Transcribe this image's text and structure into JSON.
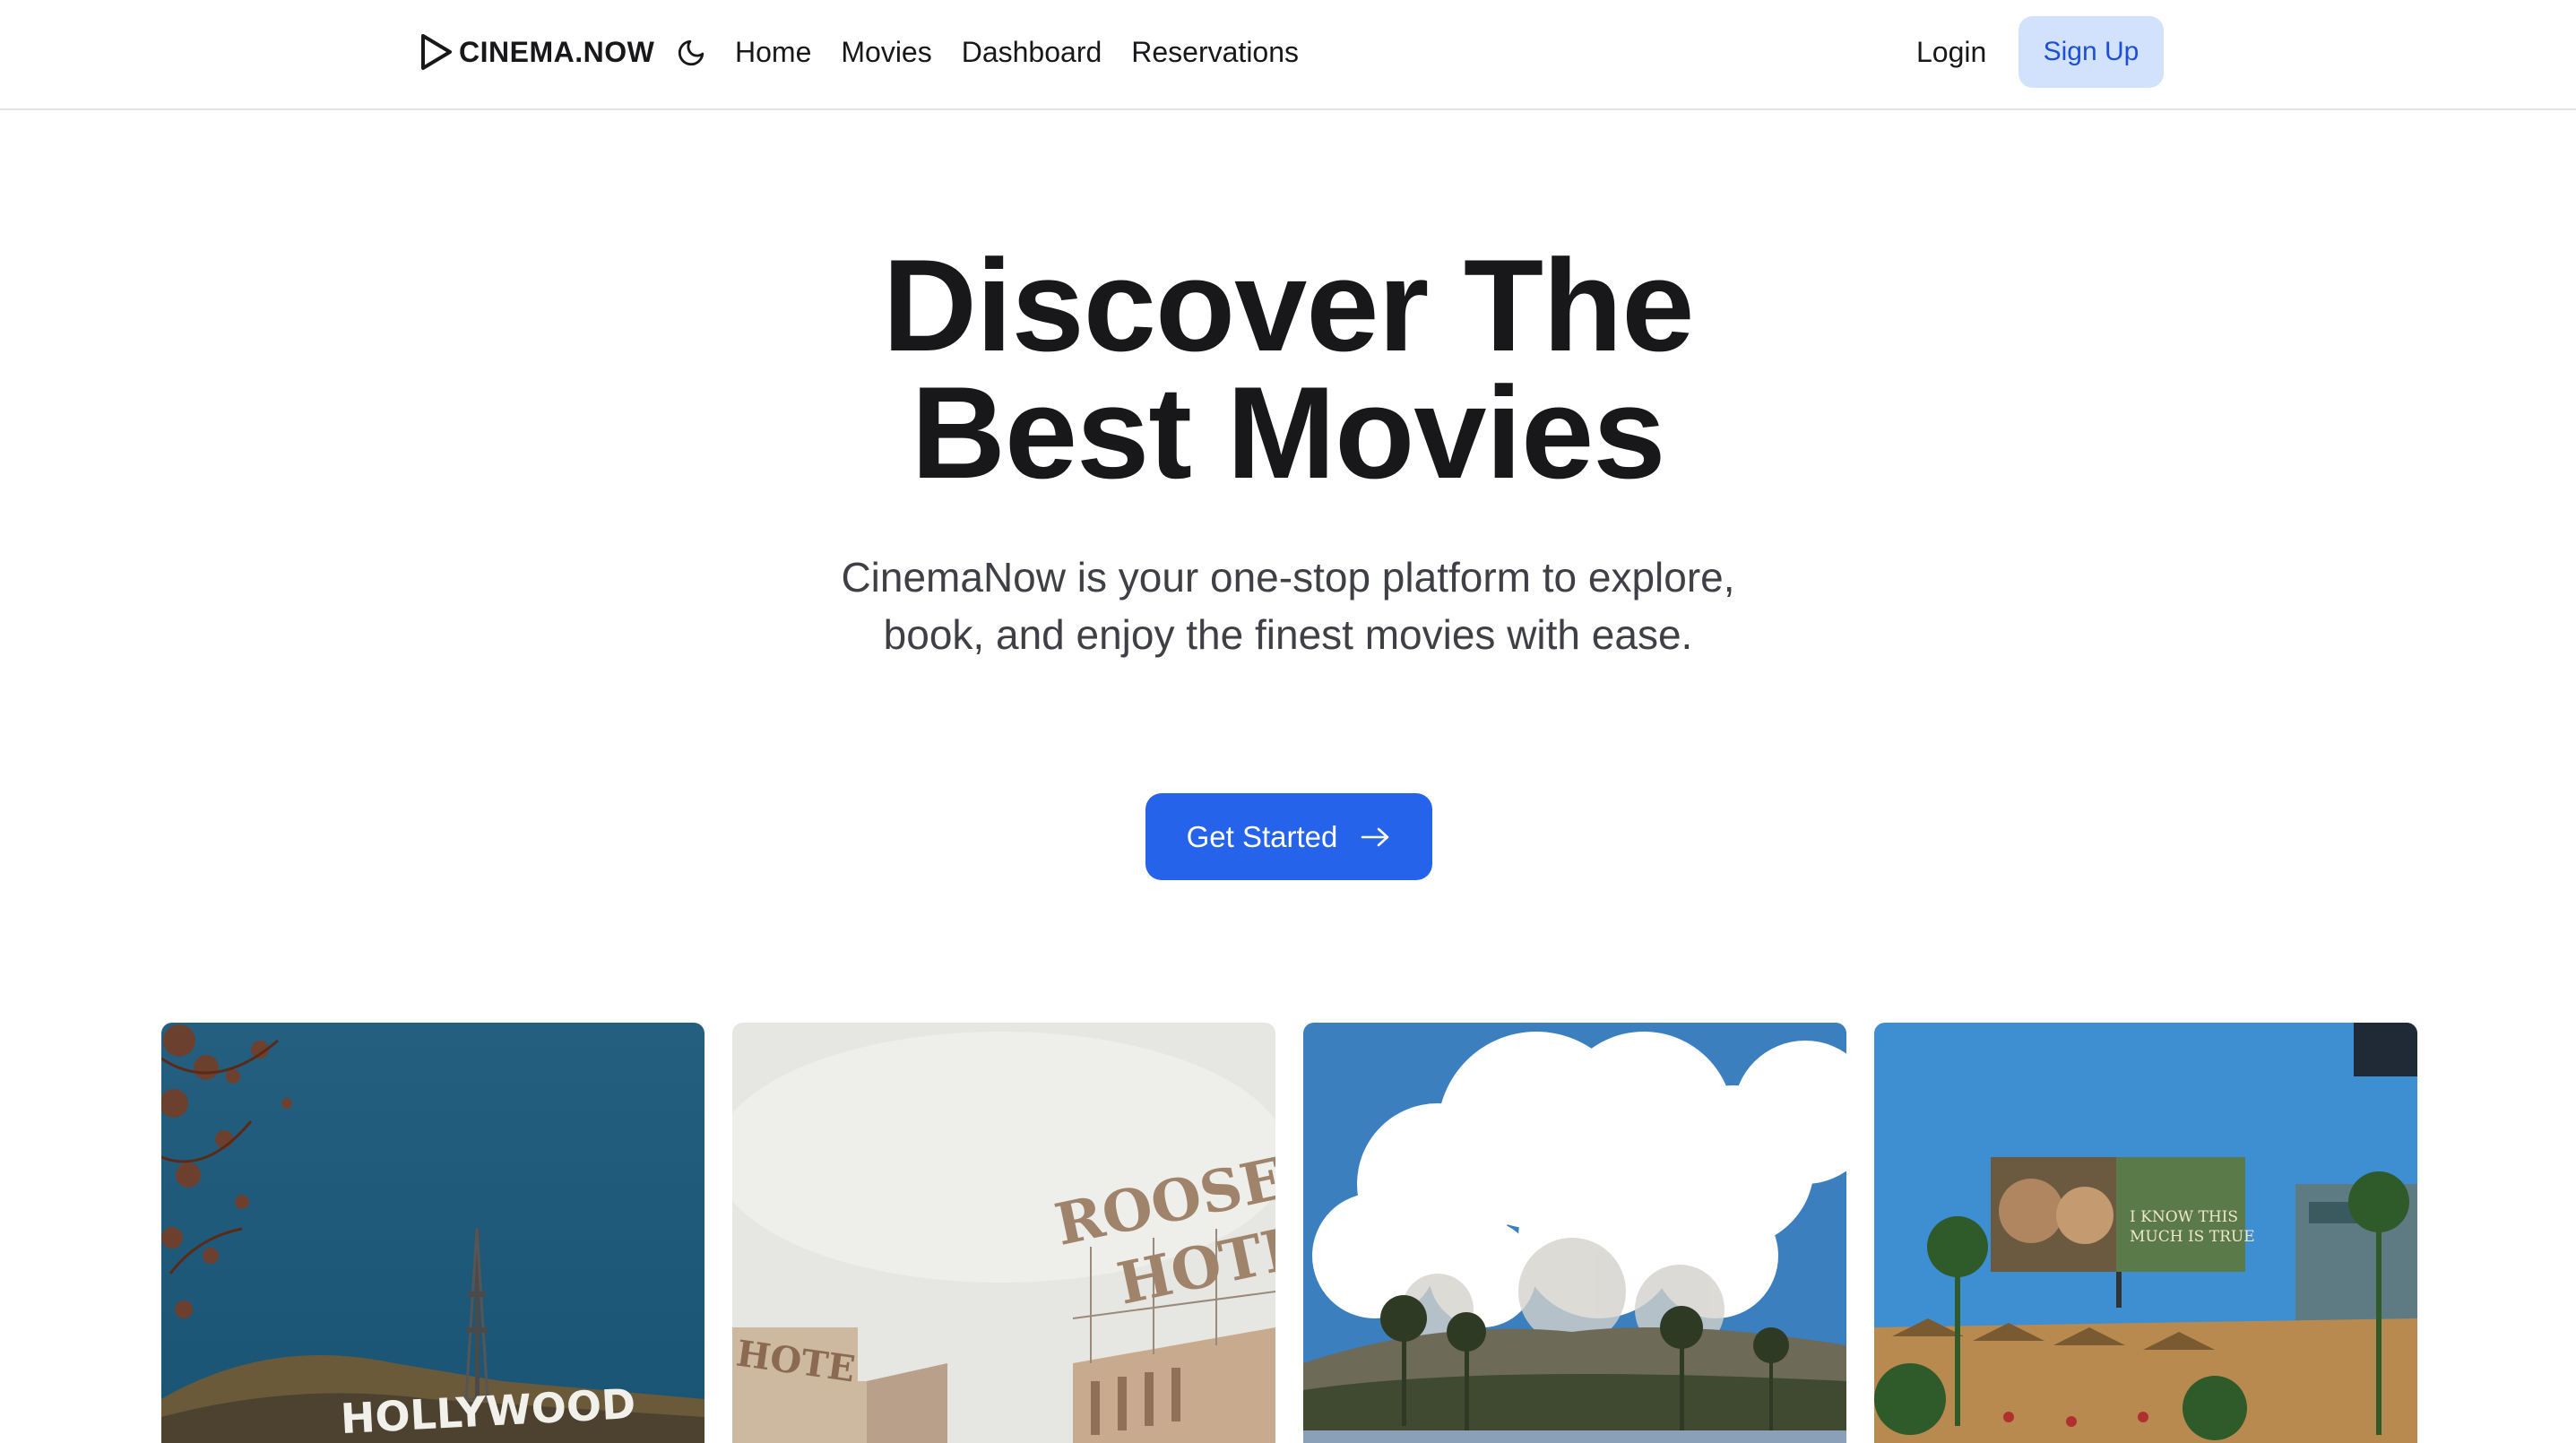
{
  "brand": {
    "name": "CINEMA.NOW"
  },
  "nav": {
    "theme_icon": "moon-icon",
    "links": [
      "Home",
      "Movies",
      "Dashboard",
      "Reservations"
    ],
    "login_label": "Login",
    "signup_label": "Sign Up"
  },
  "hero": {
    "title_line1": "Discover The",
    "title_line2": "Best Movies",
    "subtitle": "CinemaNow is your one-stop platform to explore, book, and enjoy the finest movies with ease.",
    "cta_label": "Get Started",
    "cta_icon": "arrow-right-icon"
  },
  "gallery": {
    "images": [
      {
        "icon": "hollywood-sign-photo",
        "sign_text": "HOLLYWOOD"
      },
      {
        "icon": "roosevelt-hotel-photo",
        "sign_text_line1": "ROOSEV",
        "sign_text_line2": "HOTE",
        "side_text": "HOTE"
      },
      {
        "icon": "hollywood-hills-photo"
      },
      {
        "icon": "billboard-street-photo",
        "billboard_text_line1": "I KNOW THIS",
        "billboard_text_line2": "MUCH IS TRUE"
      }
    ]
  },
  "colors": {
    "accent": "#2563eb",
    "signup_bg": "#d3e2fc",
    "signup_text": "#1d4ed8",
    "text": "#18181b"
  }
}
